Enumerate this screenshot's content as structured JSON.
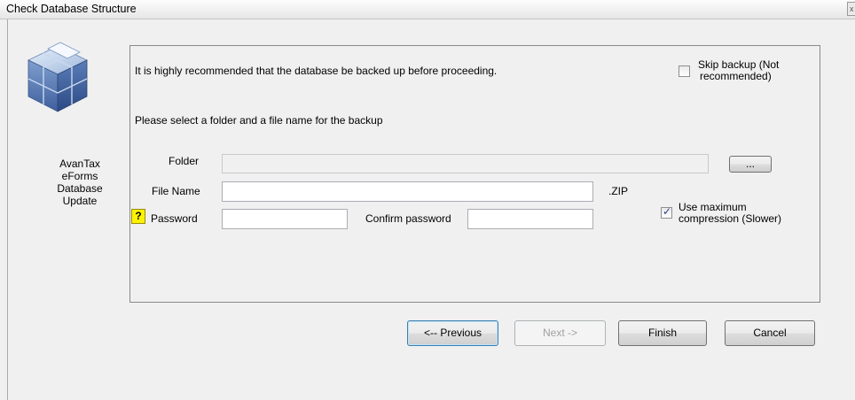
{
  "window": {
    "title": "Check Database Structure",
    "close_glyph": "x"
  },
  "sidebar": {
    "logo_icon": "cube-stack-icon",
    "app_name_lines": [
      "AvanTax",
      "eForms",
      "Database",
      "Update"
    ]
  },
  "backup": {
    "recommend_text": "It is highly recommended that the database be backed up before proceeding.",
    "skip_label_1": "Skip backup (Not",
    "skip_label_2": "recommended)",
    "skip_checked": false,
    "select_text": "Please select a folder and a file name for the backup",
    "folder_label": "Folder",
    "folder_value": "",
    "browse_label": "...",
    "filename_label": "File Name",
    "filename_value": "",
    "zip_suffix": ".ZIP",
    "help_label": "?",
    "password_label": "Password",
    "password_value": "",
    "confirm_label": "Confirm password",
    "confirm_value": "",
    "compress_label_1": "Use maximum",
    "compress_label_2": "compression (Slower)",
    "compress_checked": true
  },
  "buttons": {
    "previous": "<-- Previous",
    "next": "Next ->",
    "finish": "Finish",
    "cancel": "Cancel"
  }
}
